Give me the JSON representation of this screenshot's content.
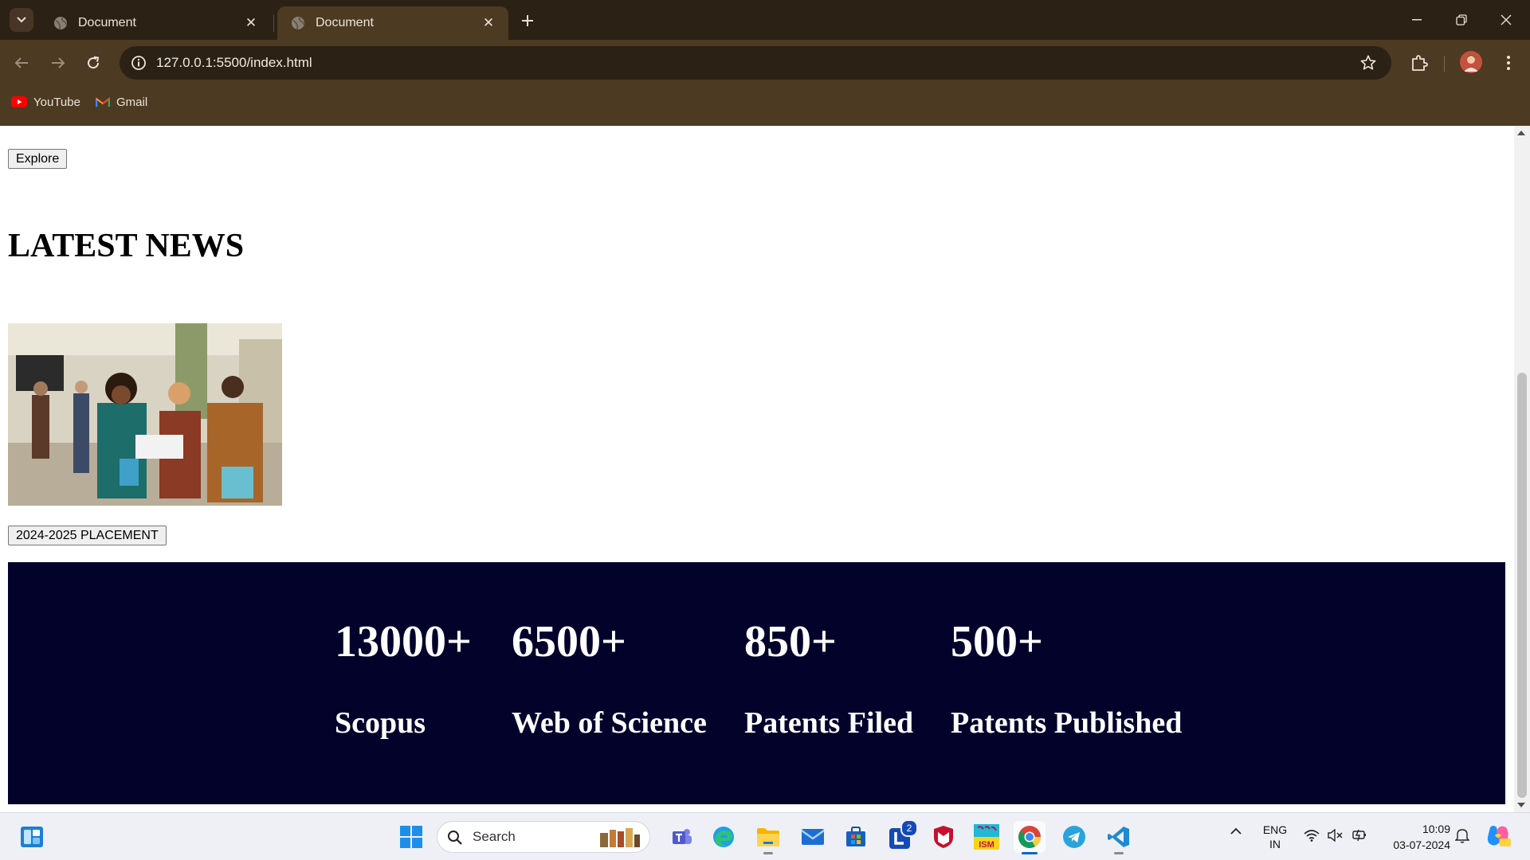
{
  "browser": {
    "tabs": [
      {
        "title": "Document",
        "active": false
      },
      {
        "title": "Document",
        "active": true
      }
    ],
    "url": "127.0.0.1:5500/index.html",
    "bookmarks": [
      {
        "label": "YouTube",
        "icon": "youtube-icon"
      },
      {
        "label": "Gmail",
        "icon": "gmail-icon"
      }
    ],
    "colors": {
      "frame": "#2c2115",
      "toolbar": "#4c3a22"
    }
  },
  "page": {
    "explore_label": "Explore",
    "news_heading": "LATEST NEWS",
    "news_image": "students-group-photo",
    "placement_label": "2024-2025 PLACEMENT",
    "stats_bg": "#02022b",
    "stats": [
      {
        "value": "13000+",
        "label": "Scopus"
      },
      {
        "value": "6500+",
        "label": "Web of Science"
      },
      {
        "value": "850+",
        "label": "Patents Filed"
      },
      {
        "value": "500+",
        "label": "Patents Published"
      }
    ]
  },
  "taskbar": {
    "search_placeholder": "Search",
    "apps": [
      "widgets-icon",
      "windows-start-icon",
      "teams-icon",
      "edge-icon",
      "file-explorer-icon",
      "mail-icon",
      "microsoft-store-icon",
      "l-app-icon",
      "mcafee-icon",
      "cisco-ism-icon",
      "chrome-icon",
      "telegram-icon",
      "vscode-icon"
    ],
    "l_app_badge": "2",
    "ism_icon_text": "ISM",
    "language": {
      "line1": "ENG",
      "line2": "IN"
    },
    "time": "10:09",
    "date": "03-07-2024"
  }
}
